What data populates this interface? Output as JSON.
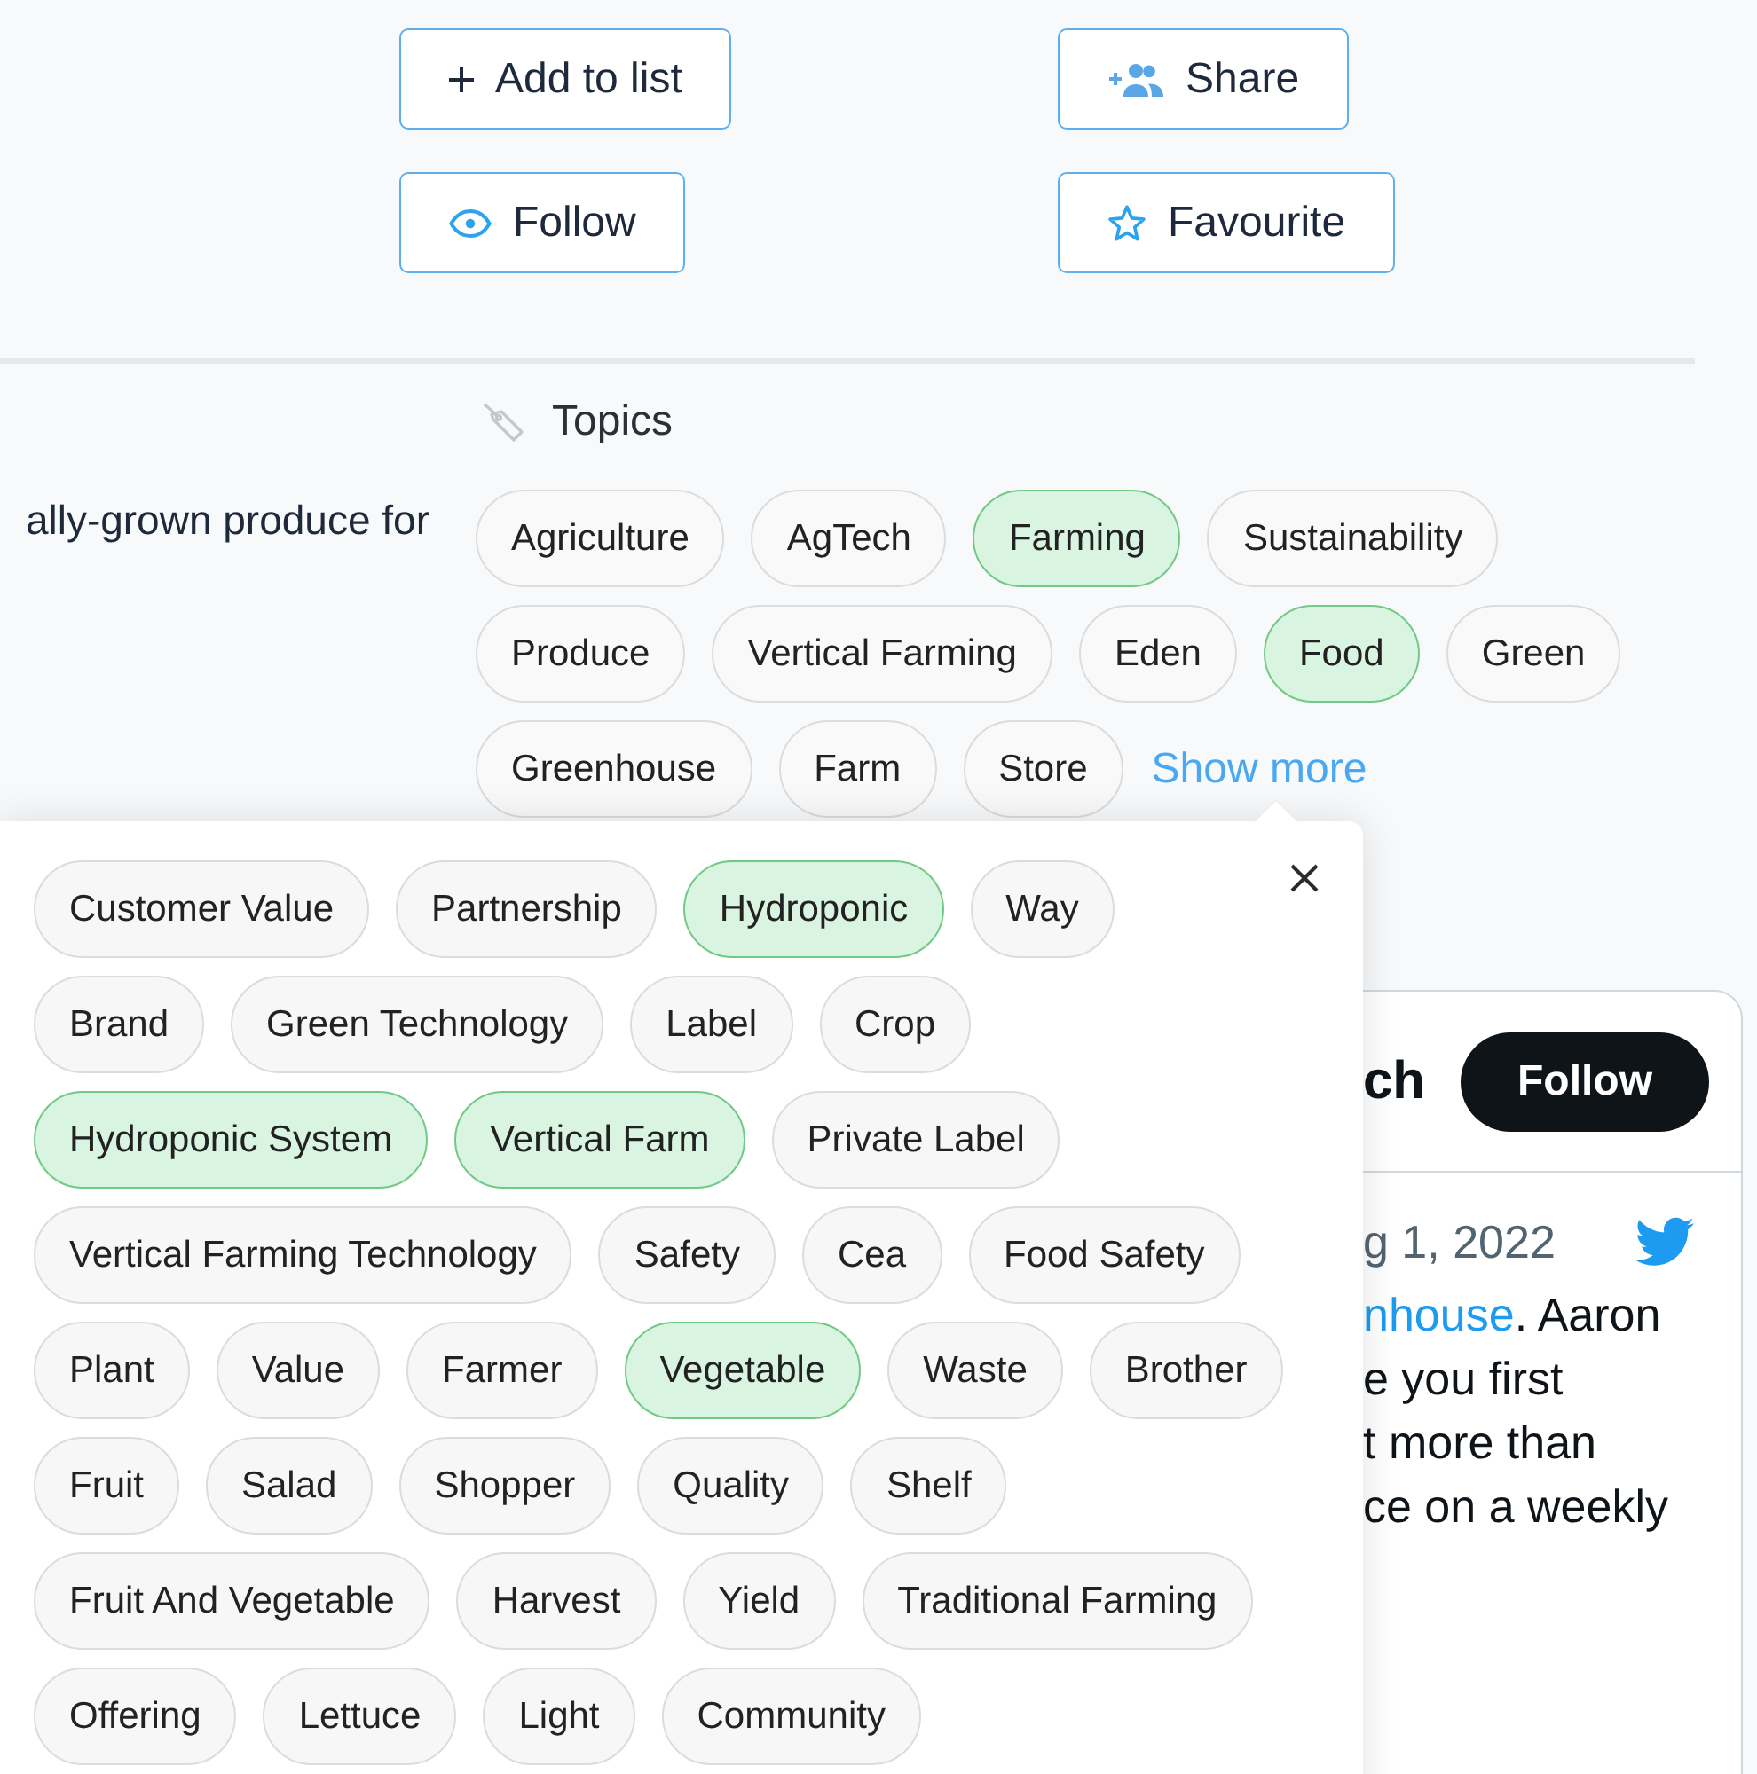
{
  "actions": [
    {
      "kind": "add",
      "label": "Add to list"
    },
    {
      "kind": "share",
      "label": "Share"
    },
    {
      "kind": "follow",
      "label": "Follow"
    },
    {
      "kind": "favourite",
      "label": "Favourite"
    }
  ],
  "description": "ally-grown produce for",
  "topics": {
    "title": "Topics",
    "tags": [
      {
        "label": "Agriculture",
        "selected": false
      },
      {
        "label": "AgTech",
        "selected": false
      },
      {
        "label": "Farming",
        "selected": true
      },
      {
        "label": "Sustainability",
        "selected": false
      },
      {
        "label": "Produce",
        "selected": false
      },
      {
        "label": "Vertical Farming",
        "selected": false
      },
      {
        "label": "Eden",
        "selected": false
      },
      {
        "label": "Food",
        "selected": true
      },
      {
        "label": "Green",
        "selected": false
      },
      {
        "label": "Greenhouse",
        "selected": false
      },
      {
        "label": "Farm",
        "selected": false
      },
      {
        "label": "Store",
        "selected": false
      }
    ],
    "show_more": "Show more"
  },
  "tweet_card": {
    "author": "ch",
    "follow_label": "Follow",
    "date": "g 1, 2022",
    "lines": [
      {
        "link": "nhouse",
        "text": ". Aaron"
      },
      {
        "text": "e you first"
      },
      {
        "text": "t more than"
      },
      {
        "text": "ce on a weekly"
      }
    ]
  },
  "topics_popover": {
    "tags": [
      {
        "label": "Customer Value",
        "selected": false
      },
      {
        "label": "Partnership",
        "selected": false
      },
      {
        "label": "Hydroponic",
        "selected": true
      },
      {
        "label": "Way",
        "selected": false
      },
      {
        "label": "Brand",
        "selected": false
      },
      {
        "label": "Green Technology",
        "selected": false
      },
      {
        "label": "Label",
        "selected": false
      },
      {
        "label": "Crop",
        "selected": false
      },
      {
        "label": "Hydroponic System",
        "selected": true
      },
      {
        "label": "Vertical Farm",
        "selected": true
      },
      {
        "label": "Private Label",
        "selected": false
      },
      {
        "label": "Vertical Farming Technology",
        "selected": false
      },
      {
        "label": "Safety",
        "selected": false
      },
      {
        "label": "Cea",
        "selected": false
      },
      {
        "label": "Food Safety",
        "selected": false
      },
      {
        "label": "Plant",
        "selected": false
      },
      {
        "label": "Value",
        "selected": false
      },
      {
        "label": "Farmer",
        "selected": false
      },
      {
        "label": "Vegetable",
        "selected": true
      },
      {
        "label": "Waste",
        "selected": false
      },
      {
        "label": "Brother",
        "selected": false
      },
      {
        "label": "Fruit",
        "selected": false
      },
      {
        "label": "Salad",
        "selected": false
      },
      {
        "label": "Shopper",
        "selected": false
      },
      {
        "label": "Quality",
        "selected": false
      },
      {
        "label": "Shelf",
        "selected": false
      },
      {
        "label": "Fruit And Vegetable",
        "selected": false
      },
      {
        "label": "Harvest",
        "selected": false
      },
      {
        "label": "Yield",
        "selected": false
      },
      {
        "label": "Traditional Farming",
        "selected": false
      },
      {
        "label": "Offering",
        "selected": false
      },
      {
        "label": "Lettuce",
        "selected": false
      },
      {
        "label": "Light",
        "selected": false
      },
      {
        "label": "Community",
        "selected": false
      }
    ]
  }
}
